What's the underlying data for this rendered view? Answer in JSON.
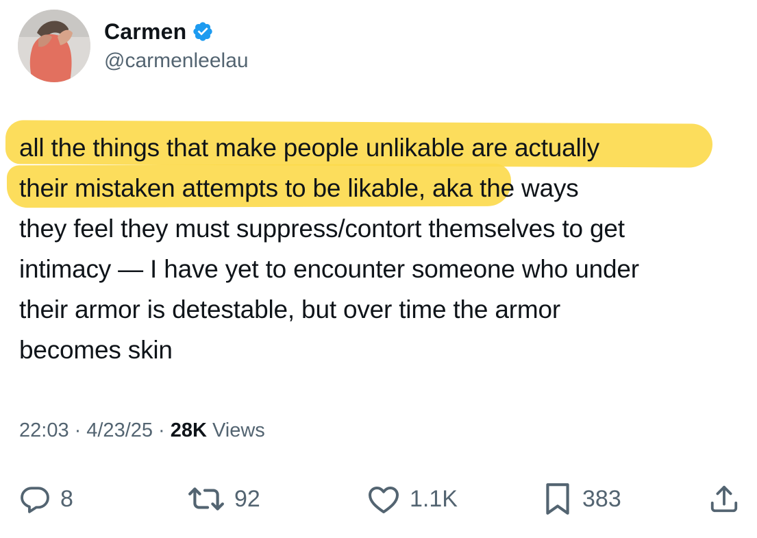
{
  "author": {
    "display_name": "Carmen",
    "handle": "@carmenleelau",
    "verified": true,
    "verified_color": "#1d9bf0",
    "avatar_icon": "profile-photo"
  },
  "tweet": {
    "lines": [
      {
        "highlighted": "all the things that make people unlikable are actually",
        "rest": ""
      },
      {
        "highlighted": "their mistaken attempts to be likable",
        "rest": ", aka the ways"
      },
      {
        "highlighted": "",
        "rest": "they feel they must suppress/contort themselves to get"
      },
      {
        "highlighted": "",
        "rest": "intimacy — I have yet to encounter someone who under"
      },
      {
        "highlighted": "",
        "rest": "their armor is detestable, but over time the armor"
      },
      {
        "highlighted": "",
        "rest": "becomes skin"
      }
    ],
    "highlight_color": "#fcd94a"
  },
  "meta": {
    "time": "22:03",
    "date": "4/23/25",
    "separator": "·",
    "views_count": "28K",
    "views_label": "Views"
  },
  "actions": {
    "replies": "8",
    "reposts": "92",
    "likes": "1.1K",
    "bookmarks": "383",
    "icons": [
      "reply-icon",
      "repost-icon",
      "like-icon",
      "bookmark-icon",
      "share-icon"
    ]
  },
  "colors": {
    "text": "#0f1419",
    "secondary": "#536471"
  }
}
